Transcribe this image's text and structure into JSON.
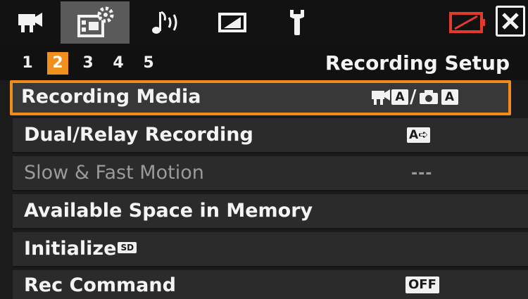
{
  "tabs": [
    {
      "icon": "movie-camera-icon",
      "active": false
    },
    {
      "icon": "recording-setup-icon",
      "active": true
    },
    {
      "icon": "audio-icon",
      "active": false
    },
    {
      "icon": "display-icon",
      "active": false
    },
    {
      "icon": "wrench-icon",
      "active": false
    }
  ],
  "status": {
    "battery_icon": "battery-warning-icon",
    "battery_color": "#e23b2e"
  },
  "close_icon": "close-icon",
  "pages": [
    "1",
    "2",
    "3",
    "4",
    "5"
  ],
  "active_page": "2",
  "page_title": "Recording Setup",
  "colors": {
    "accent": "#f0901c",
    "row_bg": "#2b2b2b",
    "disabled_text": "#9a9a9a"
  },
  "menu": [
    {
      "label": "Recording Media",
      "selected": true,
      "value": {
        "movie_slot": "A",
        "separator": "/",
        "photo_slot": "A"
      }
    },
    {
      "label": "Dual/Relay Recording",
      "value": {
        "icon_letter": "A"
      }
    },
    {
      "label": "Slow & Fast Motion",
      "disabled": true,
      "value": {
        "text": "---"
      }
    },
    {
      "label": "Available Space in Memory"
    },
    {
      "label": "Initialize",
      "badge": "SD"
    },
    {
      "label": "Rec Command",
      "value": {
        "text": "OFF"
      }
    }
  ]
}
